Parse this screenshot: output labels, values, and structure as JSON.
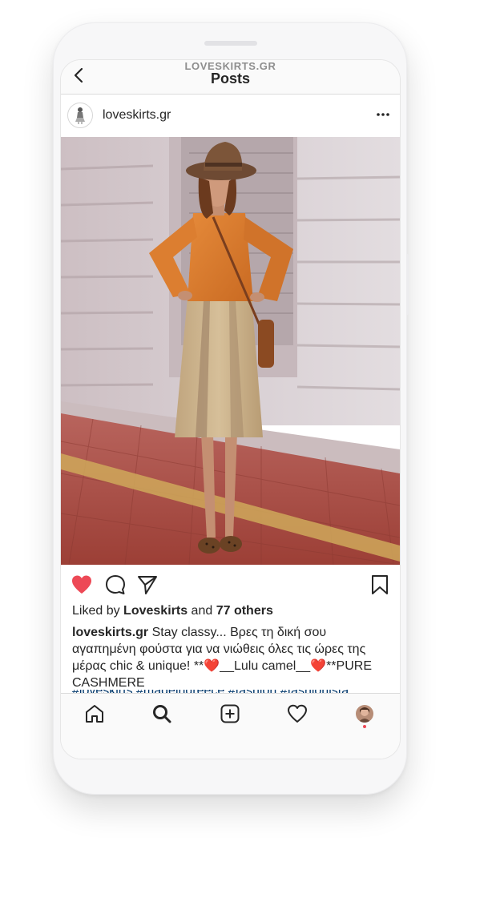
{
  "header": {
    "username": "LOVESKIRTS.GR",
    "title": "Posts",
    "back_icon": "chevron-left-icon"
  },
  "post": {
    "username": "loveskirts.gr",
    "more_icon": "more-horizontal-icon",
    "photo_alt": "Woman in orange shirt, wide-brim hat and beige pleated skirt on a city sidewalk",
    "liked_by_prefix": "Liked by",
    "liked_by_user": "Loveskirts",
    "liked_and": "and",
    "liked_others": "77 others",
    "caption_user": "loveskirts.gr",
    "caption_text_1": "Stay classy... Βρες τη δική σου αγαπημένη φούστα για να νιώθεις όλες τις ώρες της μέρας chic & unique! **",
    "caption_heart_1": "❤️",
    "caption_text_2": "__Lulu camel__",
    "caption_heart_2": "❤️",
    "caption_text_3": "**PURE CASHMERE",
    "hashtags": "#loveskirts #madeingreece #fashion #fashionista",
    "liked": true
  },
  "colors": {
    "like_red": "#ed4956",
    "text": "#262626",
    "hashtag": "#00376b"
  },
  "nav": {
    "icons": [
      "home-icon",
      "search-icon",
      "new-post-icon",
      "activity-heart-icon",
      "profile-avatar-icon"
    ]
  }
}
